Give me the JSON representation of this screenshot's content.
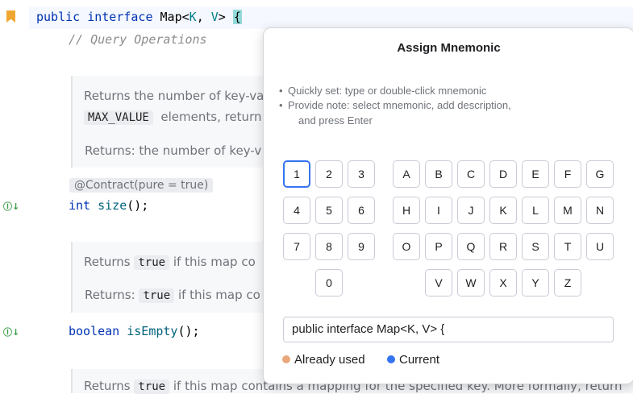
{
  "editor": {
    "line1": {
      "kw1": "public",
      "kw2": "interface",
      "name": "Map",
      "generics_open": "<",
      "k": "K",
      "sep": ", ",
      "v": "V",
      "generics_close": ">",
      "brace": "{"
    },
    "comment": "// Query Operations",
    "doc1": {
      "line1": "Returns the number of key-va",
      "chip": "MAX_VALUE",
      "line2_rest": "elements, return",
      "returns": "Returns:  the number of key-v"
    },
    "annotation": "@Contract(pure = true)",
    "size_decl": {
      "type": "int",
      "name": "size",
      "rest": "();"
    },
    "doc2": {
      "pre": "Returns",
      "chip": "true",
      "post": "if this map co",
      "ret_pre": "Returns:",
      "ret_chip": "true",
      "ret_post": "if this map co"
    },
    "isempty_decl": {
      "type": "boolean",
      "name": "isEmpty",
      "rest": "();"
    },
    "doc3": {
      "pre": "Returns",
      "chip": "true",
      "post": "if this map contains a mapping for the specified key. More formally, return"
    }
  },
  "gutter": {
    "impl_icon": "Ⓘ↓"
  },
  "popup": {
    "title": "Assign Mnemonic",
    "hints": [
      "Quickly set: type or double-click mnemonic",
      "Provide note: select mnemonic, add description,",
      "and press Enter"
    ],
    "digits": [
      "1",
      "2",
      "3",
      "4",
      "5",
      "6",
      "7",
      "8",
      "9",
      "0"
    ],
    "letters": [
      "A",
      "B",
      "C",
      "D",
      "E",
      "F",
      "G",
      "H",
      "I",
      "J",
      "K",
      "L",
      "M",
      "N",
      "O",
      "P",
      "Q",
      "R",
      "S",
      "T",
      "U",
      "V",
      "W",
      "X",
      "Y",
      "Z"
    ],
    "current_key": "1",
    "description_value": "public interface Map<K, V> {",
    "legend": {
      "used": "Already used",
      "current": "Current"
    },
    "colors": {
      "used": "#e8a87c",
      "current": "#3574f0"
    }
  }
}
